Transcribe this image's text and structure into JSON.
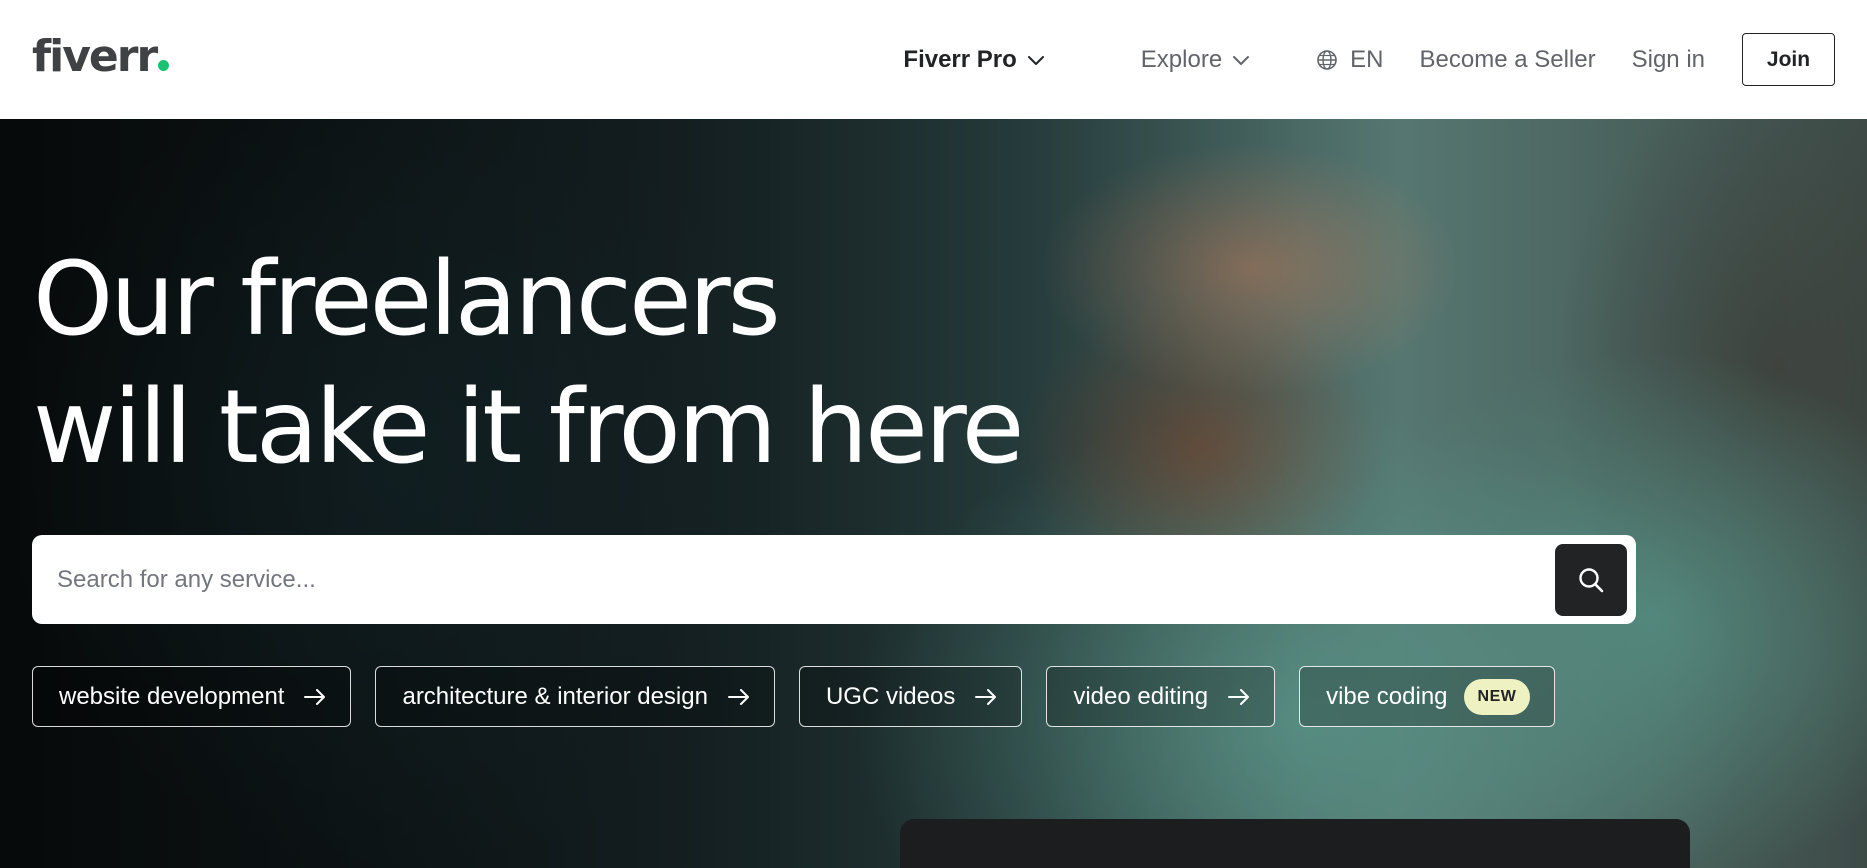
{
  "brand": {
    "logo_text": "fiverr",
    "accent": "#1dbf73"
  },
  "nav": {
    "fiverr_pro": "Fiverr Pro",
    "explore": "Explore",
    "language": "EN",
    "become_seller": "Become a Seller",
    "sign_in": "Sign in",
    "join": "Join"
  },
  "hero": {
    "title_line1": "Our freelancers",
    "title_line2": "will take it from here"
  },
  "search": {
    "placeholder": "Search for any service...",
    "value": ""
  },
  "chips": [
    {
      "label": "website development",
      "icon": "arrow-right-icon"
    },
    {
      "label": "architecture & interior design",
      "icon": "arrow-right-icon"
    },
    {
      "label": "UGC videos",
      "icon": "arrow-right-icon"
    },
    {
      "label": "video editing",
      "icon": "arrow-right-icon"
    },
    {
      "label": "vibe coding",
      "badge": "NEW"
    }
  ],
  "icons": {
    "chevron": "chevron-down-icon",
    "globe": "globe-icon",
    "search": "search-icon"
  }
}
